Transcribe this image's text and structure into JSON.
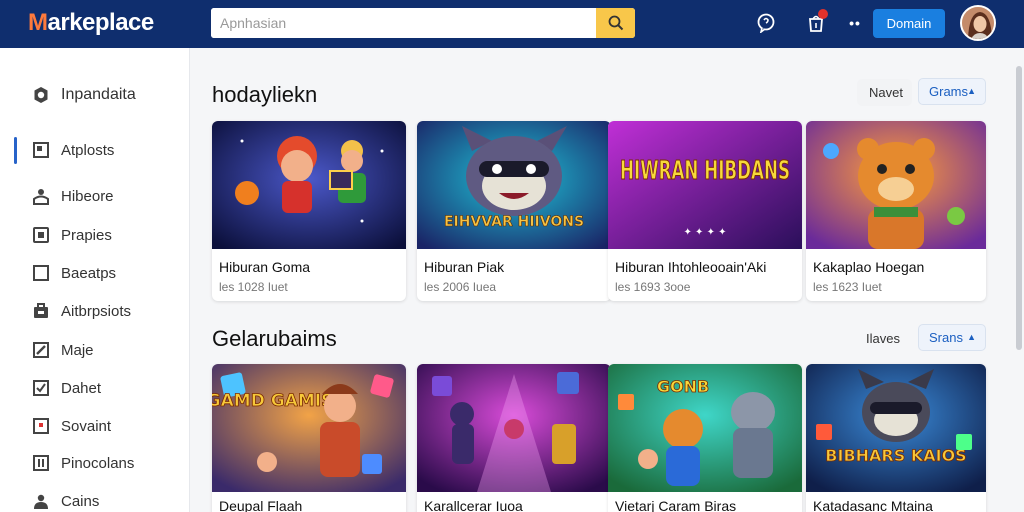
{
  "header": {
    "logo_first": "M",
    "logo_rest": "arkeplace",
    "search_placeholder": "Apnhasian",
    "domain_button": "Domain",
    "more_label": "••"
  },
  "sidebar": {
    "items": [
      {
        "label": "Inpandaita",
        "icon": "settings-cog-icon"
      },
      {
        "label": "Atplosts",
        "icon": "grid-icon"
      },
      {
        "label": "Hibeore",
        "icon": "person-icon"
      },
      {
        "label": "Prapies",
        "icon": "box-icon"
      },
      {
        "label": "Baeatps",
        "icon": "square-icon"
      },
      {
        "label": "Aitbrpsiots",
        "icon": "briefcase-icon"
      },
      {
        "label": "Maje",
        "icon": "edit-icon"
      },
      {
        "label": "Dahet",
        "icon": "check-icon"
      },
      {
        "label": "Sovaint",
        "icon": "flag-icon"
      },
      {
        "label": "Pinocolans",
        "icon": "bookmark-icon"
      },
      {
        "label": "Cains",
        "icon": "users-icon"
      }
    ]
  },
  "section1": {
    "title": "hodayliekn",
    "filter_label": "Navet",
    "filter_value": "Grams",
    "cards": [
      {
        "title": "Hiburan Goma",
        "meta": "les 1028 Iuet"
      },
      {
        "title": "Hiburan Piak",
        "meta": "les 2006 Iuea"
      },
      {
        "title": "Hiburan Ihtohleooain'Aki",
        "meta": "les 1693 3ooe"
      },
      {
        "title": "Kakaplao Hoegan",
        "meta": "les 1623 Iuet"
      }
    ],
    "thumb_texts": [
      "",
      "EIHVVAR HIIVONS",
      "HIWRAN HIBDANS",
      ""
    ]
  },
  "section2": {
    "title": "Gelarubaims",
    "filter_label": "Ilaves",
    "filter_value": "Srans",
    "cards": [
      {
        "title": "Deupal Flaah"
      },
      {
        "title": "Karallcerar Iuoa"
      },
      {
        "title": "Vietarj Caram Biras"
      },
      {
        "title": "Katadasanc Mtaina"
      }
    ],
    "thumb_texts": [
      "GAMD GAMIS",
      "",
      "GONB",
      "BIBHARS KAIOS"
    ]
  },
  "colors": {
    "topbar": "#0f2e6e",
    "accent_blue": "#1a7fe0",
    "search_button": "#f8c74a"
  }
}
